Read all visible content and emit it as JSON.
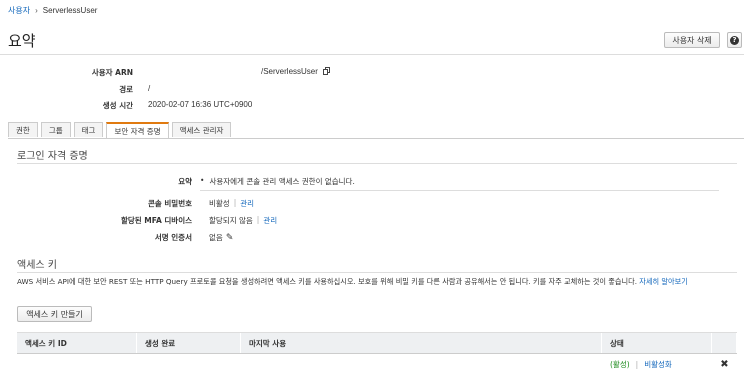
{
  "breadcrumb": {
    "parent": "사용자",
    "separator": "›",
    "current": "ServerlessUser"
  },
  "page_title": "요약",
  "header_buttons": {
    "delete_user": "사용자 삭제",
    "help": "❓"
  },
  "summary": {
    "arn_label": "사용자 ARN",
    "arn_value": "/ServerlessUser",
    "path_label": "경로",
    "path_value": "/",
    "created_label": "생성 시간",
    "created_value": "2020-02-07 16:36 UTC+0900"
  },
  "tabs": [
    "권한",
    "그룹",
    "태그",
    "보안 자격 증명",
    "액세스 관리자"
  ],
  "active_tab": "보안 자격 증명",
  "login": {
    "section_title": "로그인 자격 증명",
    "summary_label": "요약",
    "summary_value": "사용자에게 콘솔 관리 액세스 권한이 없습니다.",
    "console_pw_label": "콘솔 비밀번호",
    "console_pw_value": "비활성",
    "console_pw_manage": "관리",
    "mfa_label": "할당된 MFA 디바이스",
    "mfa_value": "할당되지 않음",
    "mfa_manage": "관리",
    "signing_label": "서명 인증서",
    "signing_value": "없음"
  },
  "access_keys": {
    "section_title": "액세스 키",
    "description": "AWS 서비스 API에 대한 보안 REST 또는 HTTP Query 프로토콜 요청을 생성하려면 액세스 키를 사용하십시오. 보호를 위해 비밀 키를 다른 사람과 공유해서는 안 됩니다. 키를 자주 교체하는 것이 좋습니다.",
    "learn_more": "자세히 알아보기",
    "create_button": "액세스 키 만들기",
    "columns": [
      "액세스 키 ID",
      "생성 완료",
      "마지막 사용",
      "상태"
    ],
    "rows": [
      {
        "key_id": "",
        "created": "",
        "last_used": "",
        "status": "(활성)",
        "action": "비활성화"
      }
    ]
  }
}
